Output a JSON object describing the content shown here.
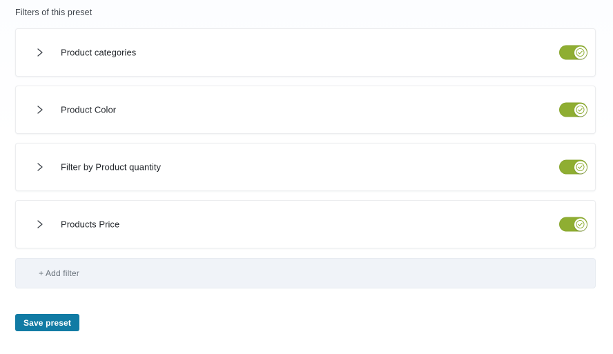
{
  "section": {
    "label": "Filters of this preset"
  },
  "filters": [
    {
      "label": "Product categories",
      "chevron_icon": "chevron-right-icon",
      "toggle_icon": "check-icon",
      "enabled": true
    },
    {
      "label": "Product Color",
      "chevron_icon": "chevron-right-icon",
      "toggle_icon": "check-icon",
      "enabled": true
    },
    {
      "label": "Filter by Product quantity",
      "chevron_icon": "chevron-right-icon",
      "toggle_icon": "check-icon",
      "enabled": true
    },
    {
      "label": "Products Price",
      "chevron_icon": "chevron-right-icon",
      "toggle_icon": "check-icon",
      "enabled": true
    }
  ],
  "add_filter": {
    "label": "+ Add filter"
  },
  "save": {
    "label": "Save preset"
  },
  "colors": {
    "toggle_on": "#8fae32",
    "toggle_check": "#8fae32",
    "save_button": "#117ba4",
    "add_filter_bg": "#f0f3f8",
    "card_bg": "#ffffff",
    "card_border": "#ecedef",
    "page_bg": "#fdfeff",
    "label_text": "#3c424a",
    "filter_text": "#22262b",
    "add_filter_text": "#6a737c"
  }
}
